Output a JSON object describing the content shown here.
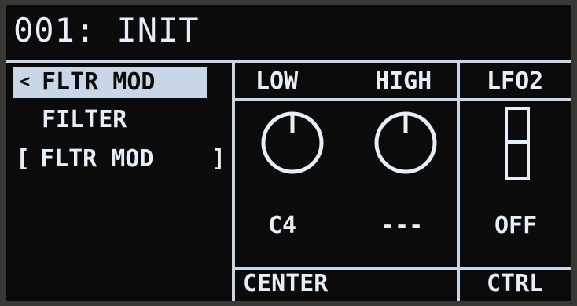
{
  "display": {
    "title": "001: INIT",
    "tab": {
      "arrow": "<",
      "label": "FLTR MOD"
    },
    "left_panel": {
      "label": "FILTER",
      "bracket_open": "[",
      "value": "FLTR MOD",
      "bracket_close": "]"
    },
    "knobs": [
      {
        "label": "LOW",
        "value": "C4"
      },
      {
        "label": "HIGH",
        "value": "---"
      }
    ],
    "lfo": {
      "label": "LFO2",
      "value": "OFF"
    },
    "footer": {
      "center": "CENTER",
      "ctrl": "CTRL"
    },
    "colors": {
      "foreground": "#e6eef7",
      "line": "#c9d6e6",
      "background": "#0b0b0b"
    }
  }
}
